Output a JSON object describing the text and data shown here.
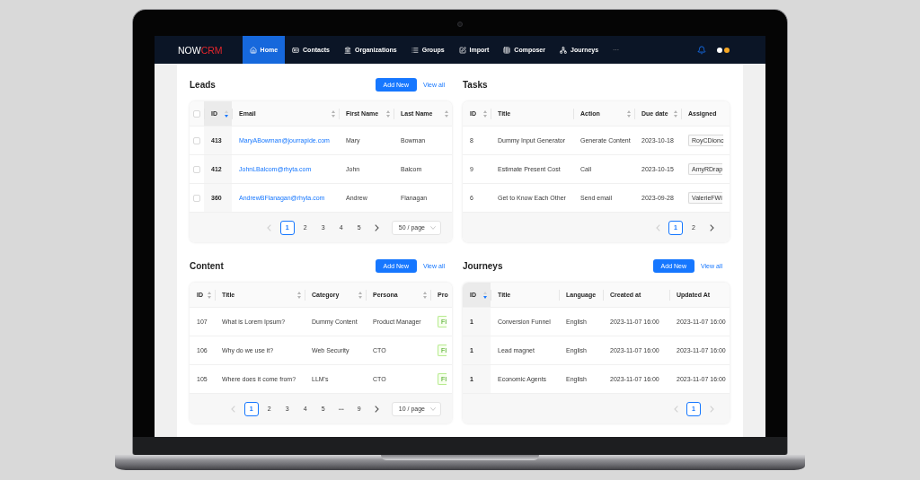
{
  "nav": {
    "logo": {
      "main": "NOW",
      "accent": "CRM"
    },
    "items": [
      {
        "label": "Home",
        "selected": true
      },
      {
        "label": "Contacts",
        "selected": false
      },
      {
        "label": "Organizations",
        "selected": false
      },
      {
        "label": "Groups",
        "selected": false
      },
      {
        "label": "Import",
        "selected": false
      },
      {
        "label": "Composer",
        "selected": false
      },
      {
        "label": "Journeys",
        "selected": false
      }
    ],
    "more": "···"
  },
  "panels": [
    {
      "title": "Leads",
      "add_button": "Add New",
      "view_all": "View all",
      "table": {
        "select_all": {
          "checked": false
        },
        "columns": [
          {
            "label": "ID",
            "kind": "text",
            "sortable": true,
            "sorted": true
          },
          {
            "label": "Email",
            "kind": "link",
            "sortable": true,
            "sorted": false
          },
          {
            "label": "First Name",
            "kind": "text",
            "sortable": true,
            "sorted": false
          },
          {
            "label": "Last Name",
            "kind": "text",
            "sortable": true,
            "sorted": false
          }
        ],
        "rows": [
          {
            "checked": false,
            "cells": [
              "413",
              "MaryABowman@jourrapide.com",
              "Mary",
              "Bowman"
            ]
          },
          {
            "checked": false,
            "cells": [
              "412",
              "JohnLBalcom@rhyta.com",
              "John",
              "Balcom"
            ]
          },
          {
            "checked": false,
            "cells": [
              "360",
              "AndrewBFlanagan@rhyta.com",
              "Andrew",
              "Flanagan"
            ]
          }
        ]
      },
      "pagination": {
        "prev_disabled": true,
        "next_disabled": false,
        "pages": [
          {
            "label": "1",
            "kind": "page",
            "selected": true
          },
          {
            "label": "2",
            "kind": "page",
            "selected": false
          },
          {
            "label": "3",
            "kind": "page",
            "selected": false
          },
          {
            "label": "4",
            "kind": "page",
            "selected": false
          },
          {
            "label": "5",
            "kind": "page",
            "selected": false
          }
        ],
        "page_size": "50 / page"
      }
    },
    {
      "title": "Tasks",
      "table": {
        "columns": [
          {
            "label": "ID",
            "kind": "text",
            "sortable": true,
            "sorted": false
          },
          {
            "label": "Title",
            "kind": "text",
            "sortable": false,
            "sorted": false
          },
          {
            "label": "Action",
            "kind": "text",
            "sortable": true,
            "sorted": false
          },
          {
            "label": "Due date",
            "kind": "text",
            "sortable": true,
            "sorted": false
          },
          {
            "label": "Assigned",
            "kind": "tag",
            "sorted": false
          }
        ],
        "rows": [
          {
            "cells": [
              "8",
              "Dummy Input Generator",
              "Generate Content",
              "2023-10-18",
              "RoyCDionc"
            ]
          },
          {
            "cells": [
              "9",
              "Estimate Present Cost",
              "Call",
              "2023-10-15",
              "AmyRDrap"
            ]
          },
          {
            "cells": [
              "6",
              "Get to Know Each Other",
              "Send email",
              "2023-09-28",
              "ValerieFWi"
            ]
          }
        ]
      },
      "pagination": {
        "prev_disabled": true,
        "next_disabled": false,
        "pages": [
          {
            "label": "1",
            "kind": "page",
            "selected": true
          },
          {
            "label": "2",
            "kind": "page",
            "selected": false
          }
        ]
      }
    },
    {
      "title": "Content",
      "add_button": "Add New",
      "view_all": "View all",
      "table": {
        "columns": [
          {
            "label": "ID",
            "kind": "text",
            "sortable": true,
            "sorted": false
          },
          {
            "label": "Title",
            "kind": "text",
            "sortable": true,
            "sorted": false
          },
          {
            "label": "Category",
            "kind": "text",
            "sortable": true,
            "sorted": false
          },
          {
            "label": "Persona",
            "kind": "text",
            "sortable": true,
            "sorted": false
          },
          {
            "label": "Pro",
            "kind": "status",
            "sorted": false
          }
        ],
        "rows": [
          {
            "cells": [
              "107",
              "What is Lorem Ipsum?",
              "Dummy Content",
              "Product Manager",
              "FI"
            ]
          },
          {
            "cells": [
              "106",
              "Why do we use it?",
              "Web Security",
              "CTO",
              "FI"
            ]
          },
          {
            "cells": [
              "105",
              "Where does it come from?",
              "LLM's",
              "CTO",
              "FI"
            ]
          }
        ]
      },
      "pagination": {
        "prev_disabled": true,
        "next_disabled": false,
        "pages": [
          {
            "label": "1",
            "kind": "page",
            "selected": true
          },
          {
            "label": "2",
            "kind": "page",
            "selected": false
          },
          {
            "label": "3",
            "kind": "page",
            "selected": false
          },
          {
            "label": "4",
            "kind": "page",
            "selected": false
          },
          {
            "label": "5",
            "kind": "page",
            "selected": false
          },
          {
            "label": "•••",
            "kind": "jump",
            "selected": false
          },
          {
            "label": "9",
            "kind": "page",
            "selected": false
          }
        ],
        "page_size": "10 / page"
      }
    },
    {
      "title": "Journeys",
      "add_button": "Add New",
      "view_all": "View all",
      "table": {
        "columns": [
          {
            "label": "ID",
            "kind": "text",
            "sortable": true,
            "sorted": true
          },
          {
            "label": "Title",
            "kind": "text",
            "sortable": false,
            "sorted": false
          },
          {
            "label": "Language",
            "kind": "text",
            "sortable": false,
            "sorted": false
          },
          {
            "label": "Created at",
            "kind": "text",
            "sortable": false,
            "sorted": false
          },
          {
            "label": "Updated At",
            "kind": "text",
            "sorted": false
          }
        ],
        "rows": [
          {
            "cells": [
              "1",
              "Conversion Funnel",
              "English",
              "2023-11-07 16:00",
              "2023-11-07 16:00"
            ]
          },
          {
            "cells": [
              "1",
              "Lead magnet",
              "English",
              "2023-11-07 16:00",
              "2023-11-07 16:00"
            ]
          },
          {
            "cells": [
              "1",
              "Economic Agents",
              "English",
              "2023-11-07 16:00",
              "2023-11-07 16:00"
            ]
          }
        ]
      },
      "pagination": {
        "prev_disabled": true,
        "next_disabled": true,
        "pages": [
          {
            "label": "1",
            "kind": "page",
            "selected": true
          }
        ]
      }
    }
  ]
}
